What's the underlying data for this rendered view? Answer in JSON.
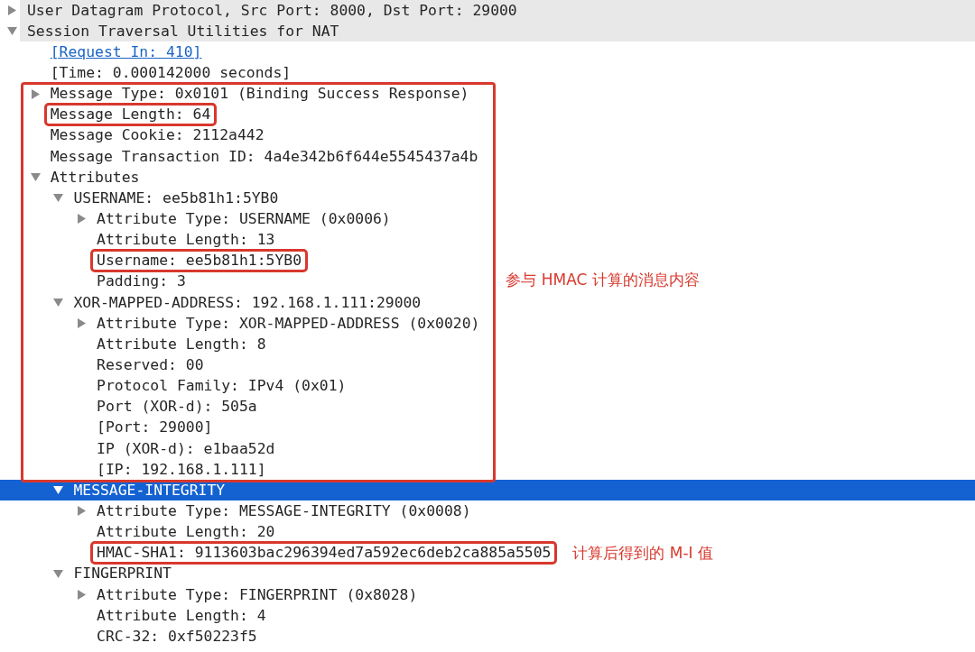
{
  "tree": [
    {
      "text": "User Datagram Protocol, Src Port: 8000, Dst Port: 29000",
      "expanded": false,
      "selected": false
    },
    {
      "text": "Session Traversal Utilities for NAT",
      "expanded": true,
      "selected": false,
      "children": [
        {
          "text": "[Request In: 410]",
          "kind": "link",
          "selected": false
        },
        {
          "text": "[Time: 0.000142000 seconds]",
          "selected": false
        },
        {
          "text": "Message Type: 0x0101 (Binding Success Response)",
          "expanded": false,
          "selected": false,
          "box_start": true,
          "box_note": "参与 HMAC 计算的消息内容"
        },
        {
          "text": "Message Length: 64",
          "selected": false,
          "boxed": true
        },
        {
          "text": "Message Cookie: 2112a442",
          "selected": false
        },
        {
          "text": "Message Transaction ID: 4a4e342b6f644e5545437a4b",
          "selected": false
        },
        {
          "text": "Attributes",
          "expanded": true,
          "selected": false,
          "children": [
            {
              "text": "USERNAME: ee5b81h1:5YB0",
              "expanded": true,
              "selected": false,
              "children": [
                {
                  "text": "Attribute Type: USERNAME (0x0006)",
                  "expanded": false,
                  "selected": false
                },
                {
                  "text": "Attribute Length: 13",
                  "selected": false
                },
                {
                  "text": "Username: ee5b81h1:5YB0",
                  "selected": false,
                  "boxed": true
                },
                {
                  "text": "Padding: 3",
                  "selected": false
                }
              ]
            },
            {
              "text": "XOR-MAPPED-ADDRESS: 192.168.1.111:29000",
              "expanded": true,
              "selected": false,
              "children": [
                {
                  "text": "Attribute Type: XOR-MAPPED-ADDRESS (0x0020)",
                  "expanded": false,
                  "selected": false
                },
                {
                  "text": "Attribute Length: 8",
                  "selected": false
                },
                {
                  "text": "Reserved: 00",
                  "selected": false
                },
                {
                  "text": "Protocol Family: IPv4 (0x01)",
                  "selected": false
                },
                {
                  "text": "Port (XOR-d): 505a",
                  "selected": false
                },
                {
                  "text": "[Port: 29000]",
                  "selected": false
                },
                {
                  "text": "IP (XOR-d): e1baa52d",
                  "selected": false
                },
                {
                  "text": "[IP: 192.168.1.111]",
                  "selected": false,
                  "box_end": true
                }
              ]
            },
            {
              "text": "MESSAGE-INTEGRITY",
              "expanded": true,
              "selected": true,
              "children": [
                {
                  "text": "Attribute Type: MESSAGE-INTEGRITY (0x0008)",
                  "expanded": false,
                  "selected": false
                },
                {
                  "text": "Attribute Length: 20",
                  "selected": false
                },
                {
                  "text": "HMAC-SHA1: 9113603bac296394ed7a592ec6deb2ca885a5505",
                  "selected": false,
                  "boxed": true,
                  "note": "计算后得到的 M-I 值"
                }
              ]
            },
            {
              "text": "FINGERPRINT",
              "expanded": true,
              "selected": false,
              "children": [
                {
                  "text": "Attribute Type: FINGERPRINT (0x8028)",
                  "expanded": false,
                  "selected": false
                },
                {
                  "text": "Attribute Length: 4",
                  "selected": false
                },
                {
                  "text": "CRC-32: 0xf50223f5",
                  "selected": false
                }
              ]
            }
          ]
        }
      ]
    }
  ]
}
